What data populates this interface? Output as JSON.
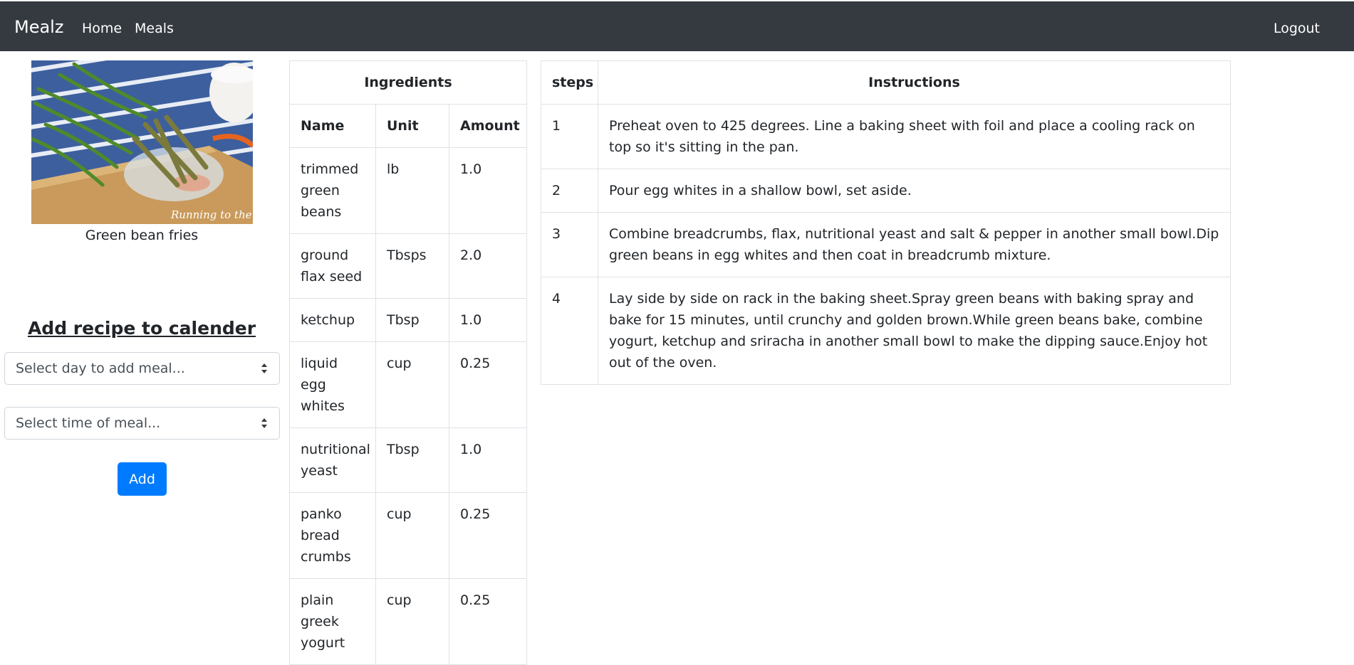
{
  "nav": {
    "brand": "Mealz",
    "home": "Home",
    "meals": "Meals",
    "logout": "Logout"
  },
  "meal": {
    "image_icon": "green-bean-fries-photo",
    "image_watermark": "Running to the Kitchen",
    "name": "Green bean fries"
  },
  "calendar": {
    "title": "Add recipe to calender",
    "day_select": "Select day to add meal...",
    "time_select": "Select time of meal...",
    "add_label": "Add"
  },
  "ingredients": {
    "caption": "Ingredients",
    "headers": [
      "Name",
      "Unit",
      "Amount"
    ],
    "rows": [
      {
        "name": "trimmed green beans",
        "unit": "lb",
        "amount": "1.0"
      },
      {
        "name": "ground flax seed",
        "unit": "Tbsps",
        "amount": "2.0"
      },
      {
        "name": "ketchup",
        "unit": "Tbsp",
        "amount": "1.0"
      },
      {
        "name": "liquid egg whites",
        "unit": "cup",
        "amount": "0.25"
      },
      {
        "name": "nutritional yeast",
        "unit": "Tbsp",
        "amount": "1.0"
      },
      {
        "name": "panko bread crumbs",
        "unit": "cup",
        "amount": "0.25"
      },
      {
        "name": "plain greek yogurt",
        "unit": "cup",
        "amount": "0.25"
      }
    ]
  },
  "steps": {
    "headers": [
      "steps",
      "Instructions"
    ],
    "rows": [
      {
        "step": "1",
        "text": "Preheat oven to 425 degrees. Line a baking sheet with foil and place a cooling rack on top so it's sitting in the pan."
      },
      {
        "step": "2",
        "text": "Pour egg whites in a shallow bowl, set aside."
      },
      {
        "step": "3",
        "text": "Combine breadcrumbs, flax, nutritional yeast and salt & pepper in another small bowl.Dip green beans in egg whites and then coat in breadcrumb mixture."
      },
      {
        "step": "4",
        "text": "Lay side by side on rack in the baking sheet.Spray green beans with baking spray and bake for 15 minutes, until crunchy and golden brown.While green beans bake, combine yogurt, ketchup and sriracha in another small bowl to make the dipping sauce.Enjoy hot out of the oven."
      }
    ]
  },
  "colors": {
    "navbar": "#343a40",
    "primary": "#007bff"
  }
}
